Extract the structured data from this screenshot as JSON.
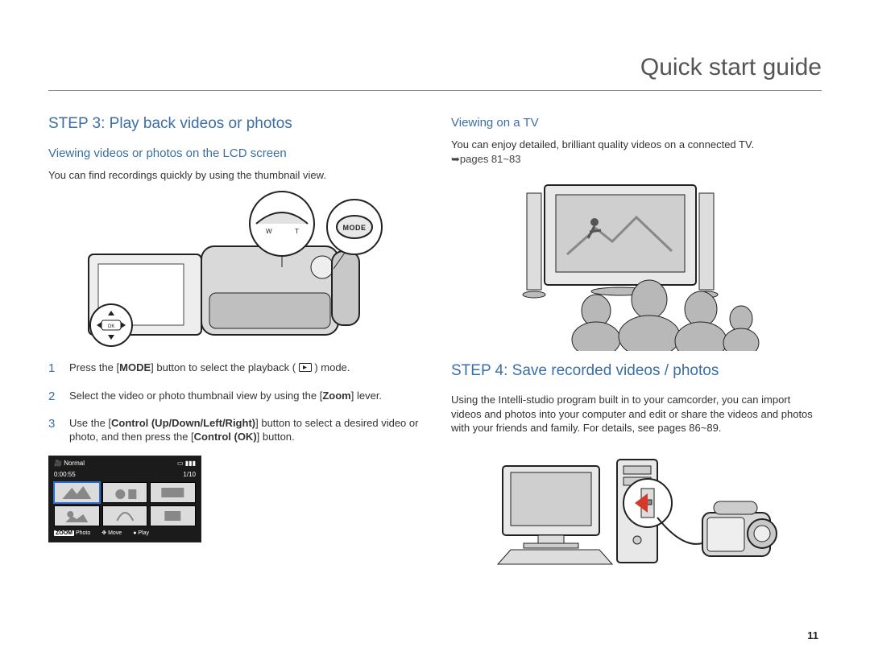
{
  "header": {
    "title": "Quick start guide"
  },
  "page_number": "11",
  "left": {
    "step_heading": "STEP 3: Play back videos or photos",
    "sub1": "Viewing videos or photos on the LCD screen",
    "intro": "You can find recordings quickly by using the thumbnail view.",
    "mode_label": "MODE",
    "steps": [
      {
        "n": "1",
        "pre": "Press the [",
        "bold1": "MODE",
        "mid": "] button to select the playback (",
        "post": ") mode."
      },
      {
        "n": "2",
        "pre": "Select the video or photo thumbnail view by using the [",
        "bold1": "Zoom",
        "mid": "] lever.",
        "post": ""
      },
      {
        "n": "3",
        "pre": "Use the [",
        "bold1": "Control (Up/Down/Left/Right)",
        "mid": "] button to select a desired video or photo, and then press the [",
        "bold2": "Control (OK)",
        "post": "] button."
      }
    ],
    "lcd": {
      "normal": "Normal",
      "time": "0:00:55",
      "count": "1/10",
      "zoom": "ZOOM",
      "photo": "Photo",
      "move": "Move",
      "play": "Play"
    }
  },
  "right": {
    "sub1": "Viewing on a TV",
    "tv_text": "You can enjoy detailed, brilliant quality videos on a connected TV.",
    "tv_ref": "➥pages 81~83",
    "step_heading": "STEP 4: Save recorded videos / photos",
    "save_text": "Using the Intelli-studio program built in to your camcorder, you can import videos and photos into your computer and edit or share the videos and photos with your friends and family. For details, see pages 86~89."
  }
}
